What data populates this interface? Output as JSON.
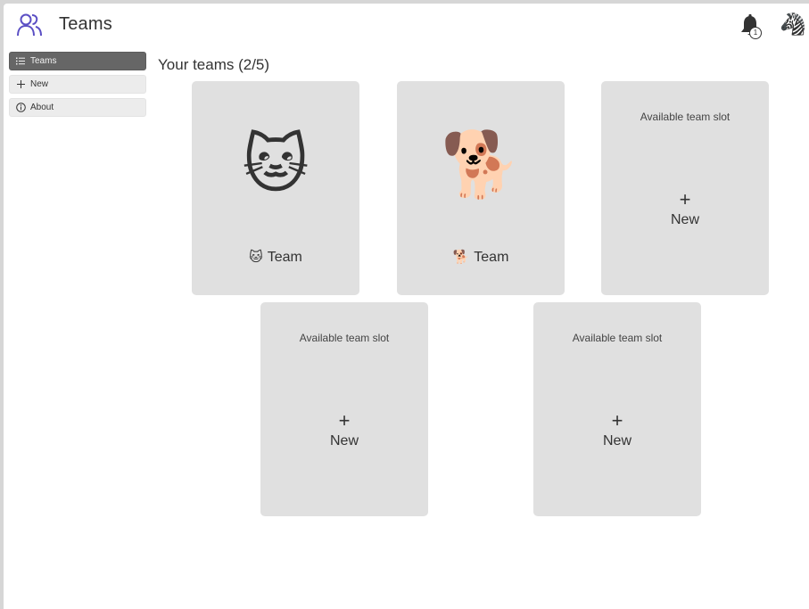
{
  "header": {
    "title": "Teams",
    "app_icon": "people-icon",
    "notification_count": "1",
    "notification_icon": "bell-icon",
    "avatar_emoji": "🦓"
  },
  "sidebar": {
    "items": [
      {
        "label": "Teams",
        "icon": "list-icon",
        "active": true
      },
      {
        "label": "New",
        "icon": "plus-icon",
        "active": false
      },
      {
        "label": "About",
        "icon": "info-icon",
        "active": false
      }
    ]
  },
  "main": {
    "title": "Your teams (2/5)",
    "teams": [
      {
        "emoji": "🐱",
        "name": "Team",
        "small_emoji": "🐱"
      },
      {
        "emoji": "🐕",
        "name": "Team",
        "small_emoji": "🐕"
      }
    ],
    "slots": [
      {
        "label": "Available team slot",
        "plus": "+",
        "new_label": "New"
      },
      {
        "label": "Available team slot",
        "plus": "+",
        "new_label": "New"
      },
      {
        "label": "Available team slot",
        "plus": "+",
        "new_label": "New"
      }
    ]
  },
  "colors": {
    "accent": "#5b4fc4",
    "card_bg": "#e0e0e0",
    "active_nav": "#666666"
  }
}
